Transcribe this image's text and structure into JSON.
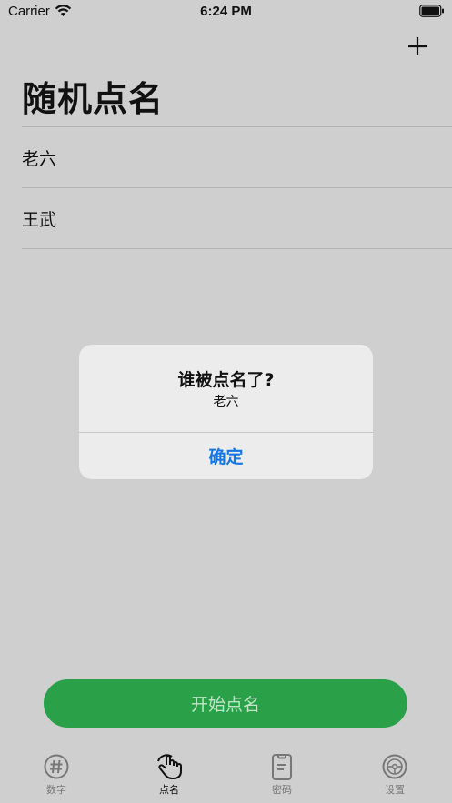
{
  "status_bar": {
    "carrier": "Carrier",
    "time": "6:24 PM"
  },
  "header": {
    "title": "随机点名",
    "add_icon": "plus-icon"
  },
  "names": [
    "老六",
    "王武"
  ],
  "alert": {
    "title": "谁被点名了?",
    "message": "老六",
    "confirm_label": "确定"
  },
  "start_button": {
    "label": "开始点名"
  },
  "tab_bar": {
    "items": [
      {
        "label": "数字",
        "icon": "hash-icon",
        "active": false
      },
      {
        "label": "点名",
        "icon": "hand-tap-icon",
        "active": true
      },
      {
        "label": "密码",
        "icon": "clipboard-icon",
        "active": false
      },
      {
        "label": "设置",
        "icon": "steering-wheel-icon",
        "active": false
      }
    ]
  },
  "colors": {
    "background": "#cfcfcf",
    "accent_green": "#2aa148",
    "alert_blue": "#1477e8"
  }
}
